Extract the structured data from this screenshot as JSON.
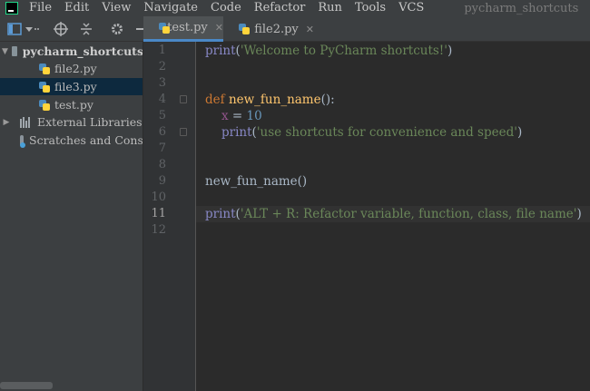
{
  "menubar": {
    "items": [
      "File",
      "Edit",
      "View",
      "Navigate",
      "Code",
      "Refactor",
      "Run",
      "Tools",
      "VCS"
    ],
    "mnemonics": [
      "F",
      "E",
      "V",
      "N",
      "C",
      "R",
      "u",
      "T",
      "S"
    ],
    "project_title": "pycharm_shortcuts"
  },
  "toolbar": {
    "icons": [
      "project-view-icon",
      "dropdown-icon",
      "locate-icon",
      "collapse-icon",
      "settings-icon",
      "hide-icon"
    ]
  },
  "project_tree": {
    "root": "pycharm_shortcuts",
    "files": [
      "file2.py",
      "file3.py",
      "test.py"
    ],
    "selected": "file3.py",
    "external_libraries": "External Libraries",
    "scratches": "Scratches and Conso"
  },
  "tabs": [
    {
      "label": "test.py",
      "active": true
    },
    {
      "label": "file2.py",
      "active": false
    }
  ],
  "editor": {
    "line_numbers": [
      "1",
      "2",
      "3",
      "4",
      "5",
      "6",
      "7",
      "8",
      "9",
      "10",
      "11",
      "12"
    ],
    "current_line": "11",
    "lines": {
      "l1": {
        "fn": "print",
        "open": "(",
        "str": "'Welcome to PyCharm shortcuts!'",
        "close": ")"
      },
      "l4": {
        "kw": "def",
        "name": "new_fun_name",
        "rest": "():"
      },
      "l5": {
        "var": "x",
        "op": " = ",
        "num": "10"
      },
      "l6": {
        "fn": "print",
        "open": "(",
        "str": "'use shortcuts for convenience and speed'",
        "close": ")"
      },
      "l9": {
        "call": "new_fun_name()"
      },
      "l11": {
        "fn": "print",
        "open": "(",
        "str": "'ALT + R: Refactor variable, function, class, file name'",
        "close": ")"
      }
    }
  },
  "colors": {
    "keyword": "#cc7832",
    "function_name": "#ffc66d",
    "builtin": "#8888c6",
    "string": "#6a8759",
    "number": "#6897bb",
    "parameter": "#94558d",
    "selection": "#0d293e",
    "active_tab_underline": "#4a88c7"
  }
}
